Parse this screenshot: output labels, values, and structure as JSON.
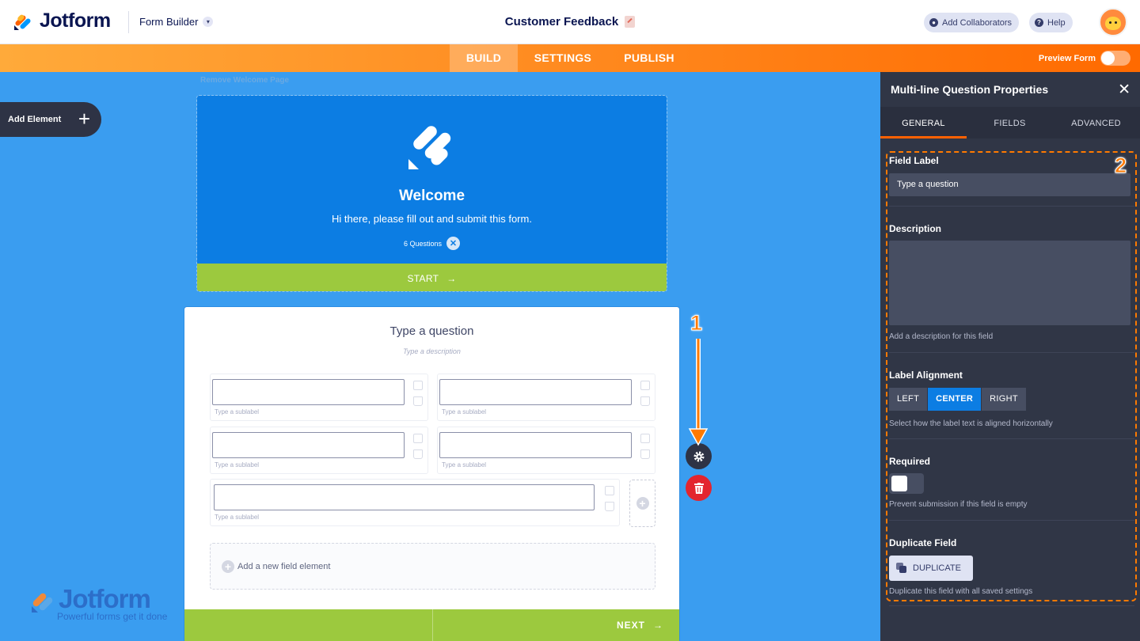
{
  "header": {
    "logo_text": "Jotform",
    "form_builder_label": "Form Builder",
    "form_title": "Customer Feedback",
    "add_collaborators": "Add Collaborators",
    "help": "Help"
  },
  "nav": {
    "tabs": [
      "BUILD",
      "SETTINGS",
      "PUBLISH"
    ],
    "active_tab": "BUILD",
    "preview_label": "Preview Form"
  },
  "canvas": {
    "add_element": "Add Element",
    "remove_welcome": "Remove Welcome Page",
    "welcome": {
      "title": "Welcome",
      "subtitle": "Hi there, please fill out and submit this form.",
      "question_count": "6 Questions",
      "start_label": "START"
    },
    "question": {
      "title": "Type a question",
      "description": "Type a description",
      "sublabel": "Type a sublabel",
      "add_field": "Add a new field element",
      "next_label": "NEXT"
    },
    "watermark": {
      "text": "Jotform",
      "tagline": "Powerful forms get it done"
    }
  },
  "annotations": {
    "one": "1",
    "two": "2"
  },
  "panel": {
    "title": "Multi-line Question Properties",
    "tabs": [
      "GENERAL",
      "FIELDS",
      "ADVANCED"
    ],
    "active_tab": "GENERAL",
    "field_label": {
      "label": "Field Label",
      "value": "Type a question"
    },
    "description": {
      "label": "Description",
      "help": "Add a description for this field"
    },
    "label_alignment": {
      "label": "Label Alignment",
      "options": [
        "LEFT",
        "CENTER",
        "RIGHT"
      ],
      "selected": "CENTER",
      "help": "Select how the label text is aligned horizontally"
    },
    "required": {
      "label": "Required",
      "help": "Prevent submission if this field is empty"
    },
    "duplicate": {
      "label": "Duplicate Field",
      "button": "DUPLICATE",
      "help": "Duplicate this field with all saved settings"
    }
  },
  "colors": {
    "canvas_bg": "#3a9df0",
    "brand_orange": "#ff6100",
    "panel_bg": "#303646",
    "green": "#9cc93e",
    "blue": "#0c7de3"
  }
}
